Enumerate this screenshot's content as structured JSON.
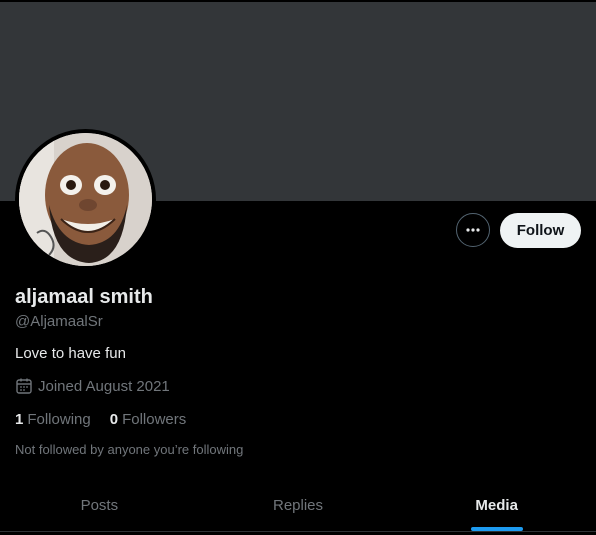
{
  "colors": {
    "background": "#000000",
    "banner": "#333639",
    "text_primary": "#e7e9ea",
    "text_secondary": "#71767b",
    "accent": "#1d9bf0",
    "follow_button_bg": "#eff3f4"
  },
  "profile": {
    "display_name": "aljamaal smith",
    "handle": "@AljamaalSr",
    "bio": "Love to have fun",
    "joined": "Joined August 2021",
    "joined_icon": "calendar-icon",
    "following_count": "1",
    "following_label": "Following",
    "followers_count": "0",
    "followers_label": "Followers",
    "followed_by": "Not followed by anyone you’re following"
  },
  "actions": {
    "more_icon": "more-dots-icon",
    "follow_label": "Follow"
  },
  "tabs": [
    {
      "label": "Posts",
      "active": false
    },
    {
      "label": "Replies",
      "active": false
    },
    {
      "label": "Media",
      "active": true
    }
  ]
}
